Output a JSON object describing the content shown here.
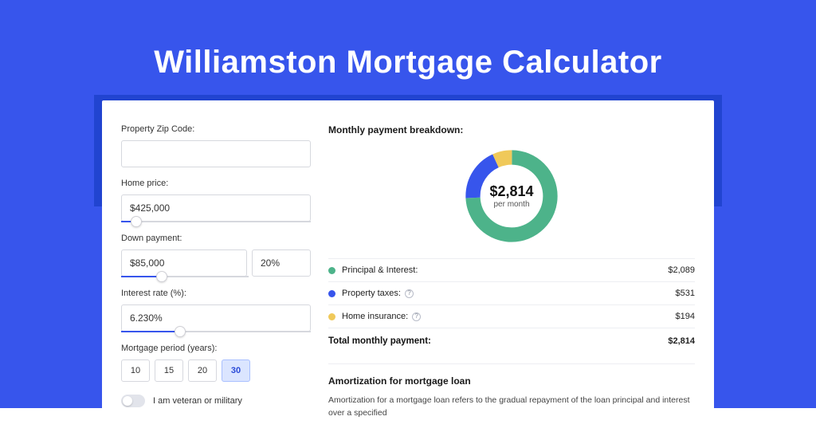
{
  "page": {
    "title": "Williamston Mortgage Calculator"
  },
  "form": {
    "zip_label": "Property Zip Code:",
    "zip_value": "",
    "home_price_label": "Home price:",
    "home_price_value": "$425,000",
    "home_price_slider_pct": 8,
    "down_payment_label": "Down payment:",
    "down_payment_value": "$85,000",
    "down_payment_pct": "20%",
    "down_payment_slider_pct": 20,
    "interest_label": "Interest rate (%):",
    "interest_value": "6.230%",
    "interest_slider_pct": 31,
    "period_label": "Mortgage period (years):",
    "period_options": [
      "10",
      "15",
      "20",
      "30"
    ],
    "period_selected": "30",
    "veteran_label": "I am veteran or military"
  },
  "breakdown": {
    "title": "Monthly payment breakdown:",
    "donut_amount": "$2,814",
    "donut_sub": "per month",
    "rows": [
      {
        "label": "Principal & Interest:",
        "value": "$2,089",
        "info": false
      },
      {
        "label": "Property taxes:",
        "value": "$531",
        "info": true
      },
      {
        "label": "Home insurance:",
        "value": "$194",
        "info": true
      }
    ],
    "total_label": "Total monthly payment:",
    "total_value": "$2,814"
  },
  "amortization": {
    "title": "Amortization for mortgage loan",
    "text": "Amortization for a mortgage loan refers to the gradual repayment of the loan principal and interest over a specified"
  },
  "chart_data": {
    "type": "pie",
    "title": "Monthly payment breakdown",
    "series": [
      {
        "name": "Principal & Interest",
        "value": 2089,
        "color": "#4db38a"
      },
      {
        "name": "Property taxes",
        "value": 531,
        "color": "#3755ec"
      },
      {
        "name": "Home insurance",
        "value": 194,
        "color": "#f0c95a"
      }
    ],
    "total": 2814,
    "center_label": "$2,814 per month"
  }
}
